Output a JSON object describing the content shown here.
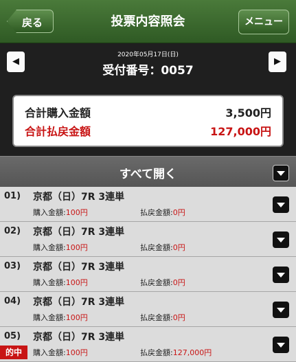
{
  "header": {
    "back_label": "戻る",
    "title": "投票内容照会",
    "menu_label": "メニュー"
  },
  "datebar": {
    "prev_arrow": "◀",
    "next_arrow": "▶",
    "date": "2020年05月17日(日)",
    "receipt": "受付番号：0057"
  },
  "summary": {
    "purchase_label": "合計購入金額",
    "purchase_value": "3,500円",
    "payout_label": "合計払戻金額",
    "payout_value": "127,000円"
  },
  "expand_all_label": "すべて開く",
  "bets": [
    {
      "num": "01)",
      "race": "京都（日）7R  3連単",
      "buy_label": "購入金額:",
      "buy_value": "100円",
      "pay_label": "払戻金額:",
      "pay_value": "0円",
      "hit": ""
    },
    {
      "num": "02)",
      "race": "京都（日）7R  3連単",
      "buy_label": "購入金額:",
      "buy_value": "100円",
      "pay_label": "払戻金額:",
      "pay_value": "0円",
      "hit": ""
    },
    {
      "num": "03)",
      "race": "京都（日）7R  3連単",
      "buy_label": "購入金額:",
      "buy_value": "100円",
      "pay_label": "払戻金額:",
      "pay_value": "0円",
      "hit": ""
    },
    {
      "num": "04)",
      "race": "京都（日）7R  3連単",
      "buy_label": "購入金額:",
      "buy_value": "100円",
      "pay_label": "払戻金額:",
      "pay_value": "0円",
      "hit": ""
    },
    {
      "num": "05)",
      "race": "京都（日）7R  3連単",
      "buy_label": "購入金額:",
      "buy_value": "100円",
      "pay_label": "払戻金額:",
      "pay_value": "127,000円",
      "hit": "的中"
    }
  ],
  "colors": {
    "header_green": "#3f6b30",
    "accent_red": "#c81414"
  },
  "icons": {
    "dropdown": "chevron-down-icon"
  }
}
